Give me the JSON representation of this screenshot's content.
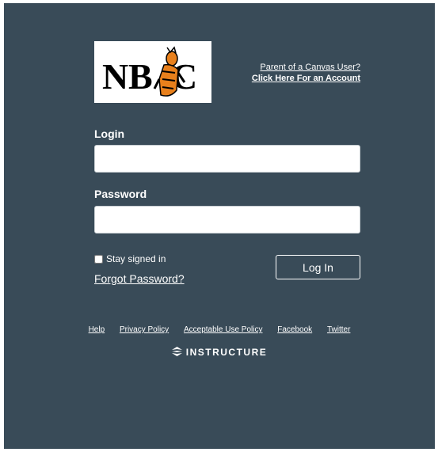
{
  "logo": {
    "text_left": "N",
    "text_mid": "B",
    "text_right": "C"
  },
  "parent_link": {
    "line1": "Parent of a Canvas User?",
    "line2": "Click Here For an Account"
  },
  "login": {
    "label": "Login",
    "value": "",
    "placeholder": ""
  },
  "password": {
    "label": "Password",
    "value": "",
    "placeholder": ""
  },
  "stay_signed_in": {
    "label": "Stay signed in",
    "checked": false
  },
  "forgot_password": "Forgot Password?",
  "login_button": "Log In",
  "footer": {
    "links": [
      "Help",
      "Privacy Policy",
      "Acceptable Use Policy",
      "Facebook",
      "Twitter"
    ],
    "brand": "INSTRUCTURE"
  },
  "colors": {
    "panel": "#394b58",
    "logo_text": "#000000",
    "mascot_orange": "#e8801c",
    "text": "#ffffff"
  },
  "icons": [
    "instructure-icon",
    "tiger-mascot-icon"
  ]
}
